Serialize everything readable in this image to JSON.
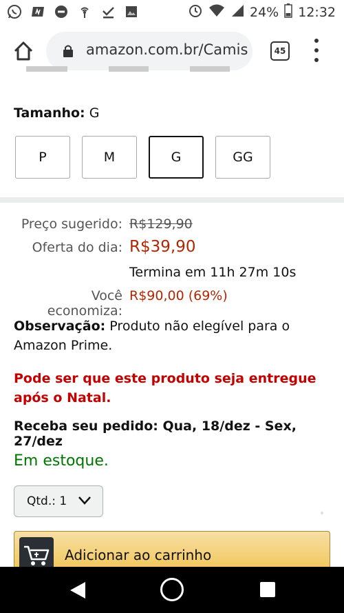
{
  "status_bar": {
    "battery": "24%",
    "time": "12:32",
    "left_icons": [
      "whatsapp-icon",
      "app-icon",
      "dnd-icon",
      "hotspot-icon",
      "download-done-icon",
      "image-icon"
    ],
    "right_icons": [
      "alarm-icon",
      "wifi-icon",
      "signal-icon",
      "battery-icon"
    ]
  },
  "browser": {
    "url": "amazon.com.br/Camis",
    "tab_count": "45"
  },
  "product": {
    "size_label": "Tamanho:",
    "size_value": "G",
    "sizes": [
      "P",
      "M",
      "G",
      "GG"
    ],
    "selected_size": "G",
    "suggested_price_label": "Preço sugerido:",
    "suggested_price": "R$129,90",
    "deal_label": "Oferta do dia:",
    "deal_price": "R$39,90",
    "deal_timer": "Termina em 11h 27m 10s",
    "savings_label": "Você economiza:",
    "savings": "R$90,00 (69%)",
    "note_label": "Observação:",
    "note_text": " Produto não elegível para o Amazon Prime.",
    "christmas_warning": "Pode ser que este produto seja entregue após o Natal.",
    "delivery": "Receba seu pedido: Qua, 18/dez - Sex, 27/dez",
    "stock": "Em estoque.",
    "qty_label": "Qtd.: 1",
    "add_to_cart": "Adicionar ao carrinho"
  },
  "colors": {
    "price_red": "#b12704",
    "stock_green": "#007600",
    "warning_red": "#c40000",
    "cart_button": "#f0c14b"
  }
}
